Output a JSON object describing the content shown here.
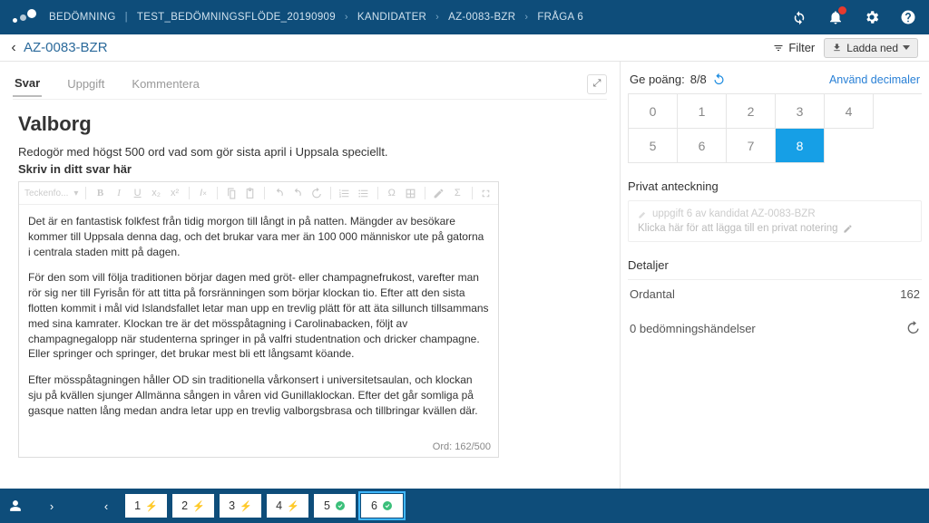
{
  "header": {
    "crumbs": [
      "BEDÖMNING",
      "TEST_BEDÖMNINGSFLÖDE_20190909",
      "KANDIDATER",
      "AZ-0083-BZR",
      "FRÅGA 6"
    ]
  },
  "subheader": {
    "title": "AZ-0083-BZR",
    "filter": "Filter",
    "download": "Ladda ned"
  },
  "tabs": {
    "answer": "Svar",
    "task": "Uppgift",
    "comment": "Kommentera"
  },
  "question": {
    "title": "Valborg",
    "desc": "Redogör med högst 500 ord vad som gör sista april i Uppsala speciellt.",
    "hint": "Skriv in ditt svar här",
    "toolbar_font": "Teckenfo...",
    "paragraphs": [
      "Det är en fantastisk folkfest från tidig morgon till långt in på natten. Mängder av besökare kommer till Uppsala denna dag, och det brukar vara mer än 100 000 människor ute på gatorna i centrala staden mitt på dagen.",
      "För den som vill följa traditionen börjar dagen med gröt- eller champagnefrukost, varefter man rör sig ner till Fyrisån för att titta på forsränningen som börjar klockan tio. Efter att den sista flotten kommit i mål vid Islandsfallet letar man upp en trevlig plätt för att äta sillunch tillsammans med sina kamrater. Klockan tre är det mösspåtagning i Carolinabacken, följt av champagnegalopp när studenterna springer in på valfri studentnation och dricker champagne. Eller springer och springer, det brukar mest bli ett långsamt köande.",
      "Efter mösspåtagningen håller OD sin traditionella vårkonsert i universitetsaulan, och klockan sju på kvällen sjunger Allmänna sången in våren vid Gunillaklockan. Efter det går somliga på gasque natten lång medan andra letar upp en trevlig valborgsbrasa och tillbringar kvällen där."
    ],
    "wordcount": "Ord: 162/500"
  },
  "score": {
    "label": "Ge poäng:",
    "value": "8/8",
    "decimals": "Använd decimaler",
    "buttons": [
      "0",
      "1",
      "2",
      "3",
      "4",
      "5",
      "6",
      "7",
      "8"
    ],
    "selected": "8"
  },
  "note": {
    "title": "Privat anteckning",
    "line1": "uppgift 6 av kandidat AZ-0083-BZR",
    "line2": "Klicka här för att lägga till en privat notering"
  },
  "details": {
    "title": "Detaljer",
    "words_label": "Ordantal",
    "words_value": "162"
  },
  "events": {
    "label": "0 bedömningshändelser"
  },
  "pager": {
    "items": [
      {
        "n": "1",
        "icon": "bolt"
      },
      {
        "n": "2",
        "icon": "bolt"
      },
      {
        "n": "3",
        "icon": "bolt"
      },
      {
        "n": "4",
        "icon": "bolt"
      },
      {
        "n": "5",
        "icon": "check"
      },
      {
        "n": "6",
        "icon": "check",
        "selected": true
      }
    ]
  }
}
